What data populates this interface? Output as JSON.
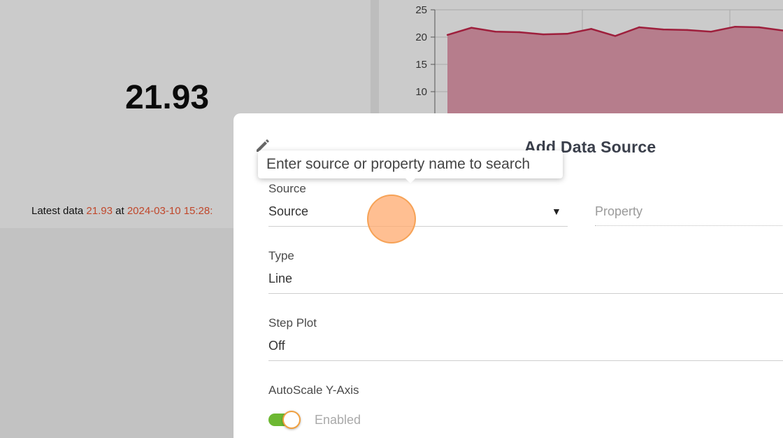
{
  "dashboard": {
    "value_widget": {
      "value": "21.93",
      "latest_prefix": "Latest data",
      "latest_value": "21.93",
      "latest_at": "at",
      "latest_timestamp": "2024-03-10 15:28:"
    },
    "chart_widget": {
      "y_ticks": [
        "25",
        "20",
        "15",
        "10"
      ]
    }
  },
  "chart_data": {
    "type": "area",
    "title": "",
    "xlabel": "",
    "ylabel": "",
    "ylim": [
      0,
      25
    ],
    "y_ticks": [
      10,
      15,
      20,
      25
    ],
    "series": [
      {
        "values": [
          20.4,
          21.7,
          21.0,
          20.9,
          20.5,
          20.6,
          21.5,
          20.2,
          21.8,
          21.4,
          21.3,
          21.0,
          21.9,
          21.8,
          21.2
        ]
      }
    ],
    "grid": true,
    "colors": {
      "line": "#9e1f3c",
      "fill": "#b67d8c"
    }
  },
  "dialog": {
    "title": "Add Data Source",
    "tooltip": "Enter source or property name to search",
    "source": {
      "label": "Source",
      "value": "Source"
    },
    "property": {
      "placeholder": "Property"
    },
    "type": {
      "label": "Type",
      "value": "Line"
    },
    "step_plot": {
      "label": "Step Plot",
      "value": "Off"
    },
    "autoscale": {
      "label": "AutoScale Y-Axis",
      "state_label": "Enabled",
      "enabled": true
    },
    "icons": {
      "edit": "pencil-icon",
      "dropdown": "triangle-down-icon"
    },
    "colors": {
      "toggle_on": "#6db832",
      "accent": "#f0a040"
    }
  }
}
